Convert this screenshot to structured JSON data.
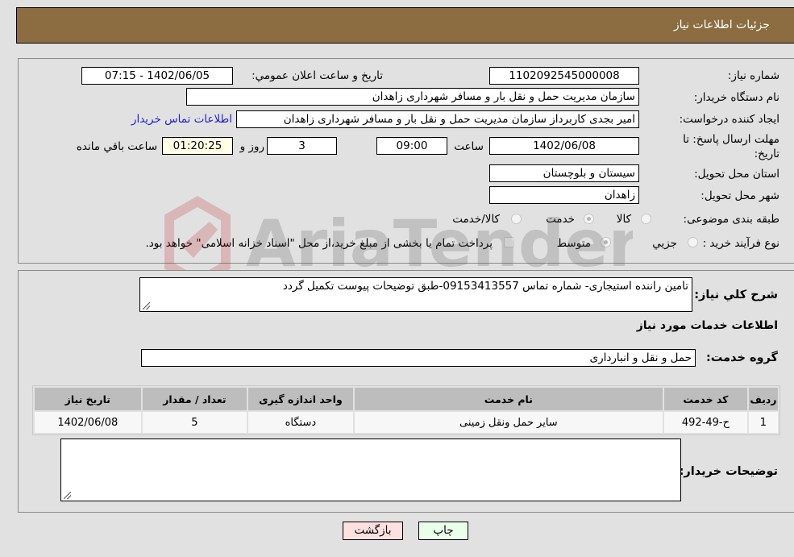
{
  "header": {
    "title": "جزئیات اطلاعات نیاز"
  },
  "form": {
    "need_number": {
      "label": "شماره نیاز:",
      "value": "1102092545000008"
    },
    "announce_datetime": {
      "label": "تاريخ و ساعت اعلان عمومي:",
      "value": "1402/06/05 - 07:15"
    },
    "buyer_org": {
      "label": "نام دستگاه خریدار:",
      "value": "سازمان مدیریت حمل و نقل بار و مسافر شهرداری زاهدان"
    },
    "requester": {
      "label": "ایجاد کننده درخواست:",
      "value": "امیر بجدی کاربرداز سازمان مدیریت حمل و نقل بار و مسافر شهرداری زاهدان"
    },
    "buyer_contact_link": "اطلاعات تماس خریدار",
    "deadline": {
      "label_line1": "مهلت ارسال پاسخ: تا",
      "label_line2": "تاریخ:",
      "date": "1402/06/08",
      "time_label": "ساعت",
      "time": "09:00",
      "days": "3",
      "days_label": "روز و",
      "remaining": "01:20:25",
      "remaining_label": "ساعت باقي مانده"
    },
    "province": {
      "label": "استان محل تحویل:",
      "value": "سیستان و بلوچستان"
    },
    "city": {
      "label": "شهر محل تحویل:",
      "value": "زاهدان"
    },
    "category": {
      "label": "طبقه بندی موضوعی:",
      "options": [
        "کالا",
        "خدمت",
        "کالا/خدمت"
      ],
      "selected": "خدمت"
    },
    "purchase_process": {
      "label": "نوع فرآیند خرید :",
      "options": [
        "جزیي",
        "متوسط"
      ],
      "selected": "متوسط",
      "treasury_note": "پرداخت تمام یا بخشی از مبلغ خرید،از محل \"اسناد خزانه اسلامی\" خواهد بود."
    }
  },
  "details": {
    "description_label": "شرح كلي نياز:",
    "description": "تامین راننده استیجاری- شماره تماس 09153413557-طبق توضیحات پیوست تکمیل گردد",
    "services_title": "اطلاعات خدمات مورد نیاز",
    "service_group_label": "گروه خدمت:",
    "service_group": "حمل و نقل و انبارداری",
    "table": {
      "headers": [
        "ردیف",
        "کد خدمت",
        "نام خدمت",
        "واحد اندازه گیری",
        "تعداد / مقدار",
        "تاریخ نیاز"
      ],
      "rows": [
        [
          "1",
          "ح-49-492",
          "سایر حمل ونقل زمینی",
          "دستگاه",
          "5",
          "1402/06/08"
        ]
      ]
    },
    "buyer_notes_label": "توضیحات خریدار:",
    "buyer_notes": ""
  },
  "buttons": {
    "print": "چاپ",
    "back": "بازگشت"
  },
  "colors": {
    "header_bg": "#8c6d42",
    "print_bg": "#eaffea",
    "back_bg": "#ffe0e0",
    "link": "#2222cc"
  }
}
